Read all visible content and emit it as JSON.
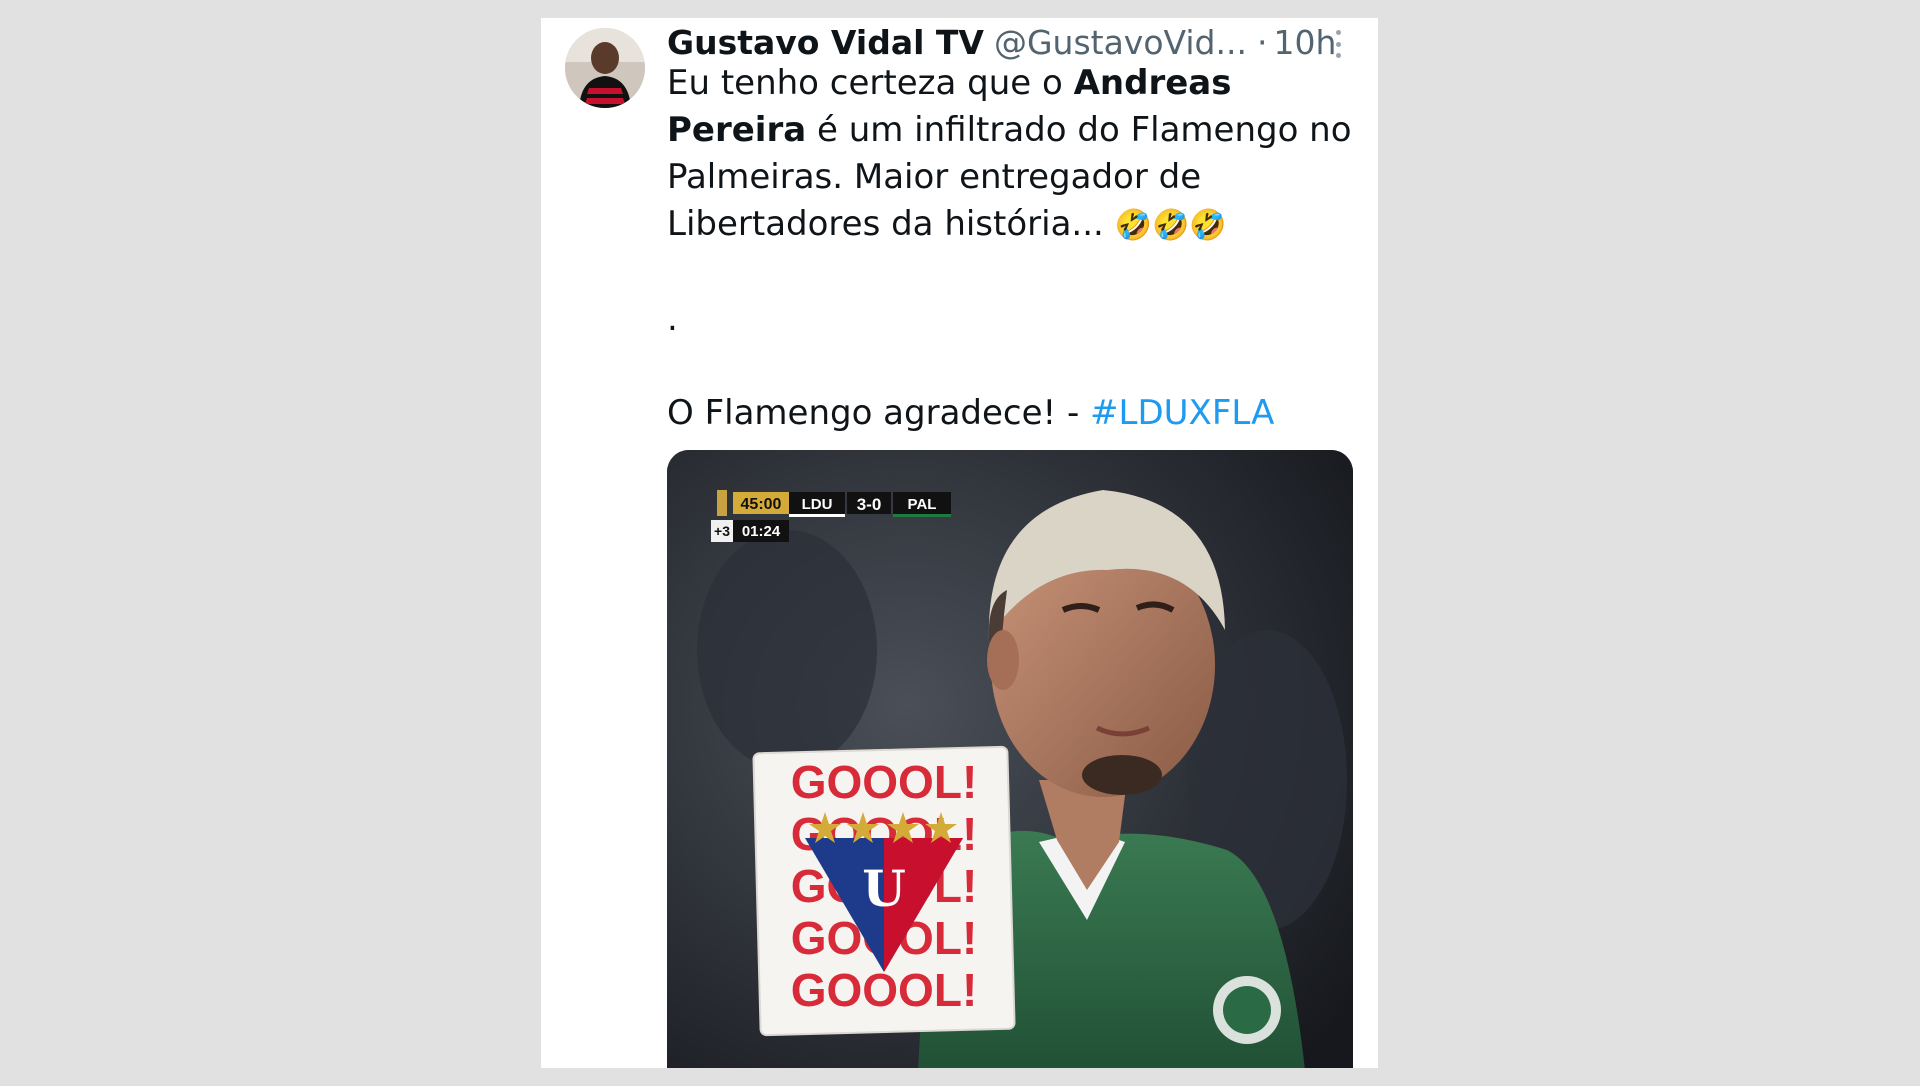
{
  "tweet": {
    "display_name": "Gustavo Vidal TV",
    "handle": "@GustavoVid...",
    "separator": "·",
    "timestamp": "10h",
    "avatar_icon": "profile-photo",
    "more_icon": "more-options-icon",
    "text": {
      "part1": "Eu tenho certeza que o ",
      "bold": "Andreas Pereira",
      "part2": " é um infiltrado do Flamengo no Palmeiras. Maior entregador de Libertadores da história... ",
      "emoji": "🤣🤣🤣",
      "dot_line": ".",
      "thanks": "O Flamengo agradece! - ",
      "hashtag": "#LDUXFLA"
    },
    "hashtag_color": "#1d9bf0"
  },
  "media": {
    "scoreboard": {
      "time": "45:00",
      "home": "LDU",
      "score": "3-0",
      "away": "PAL",
      "added_time": "+3",
      "extra_clock": "01:24"
    },
    "sticker_text": [
      "GOOOL!",
      "GOOOL!",
      "GOOOL!",
      "GOOOL!",
      "GOOOL!"
    ],
    "sticker_logo_letter": "U",
    "jersey_color": "#2f6b47",
    "sticker_text_color": "#d72b3a"
  }
}
